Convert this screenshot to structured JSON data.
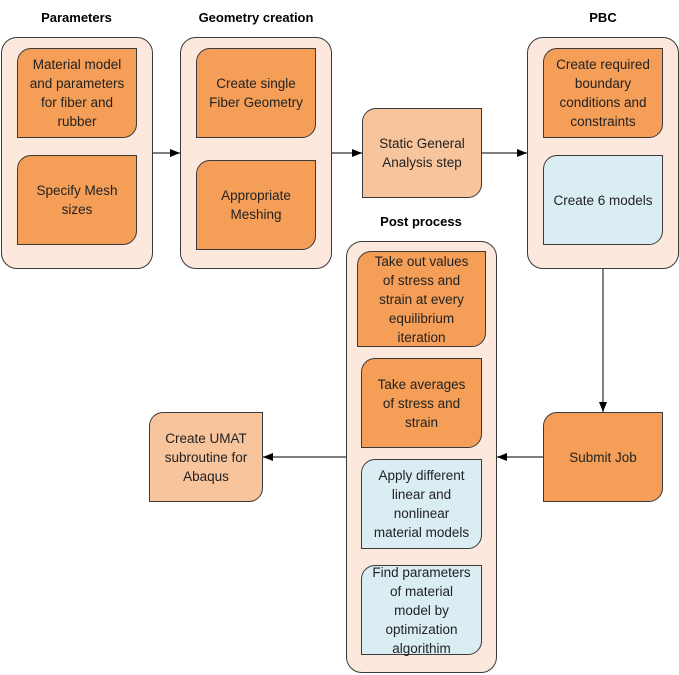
{
  "diagram": {
    "groups": {
      "parameters": {
        "title": "Parameters",
        "items": [
          "Material model\nand parameters\nfor fiber and\nrubber",
          "Specify Mesh\nsizes"
        ]
      },
      "geometry": {
        "title": "Geometry creation",
        "items": [
          "Create single\nFiber Geometry",
          "Appropriate\nMeshing"
        ]
      },
      "pbc": {
        "title": "PBC",
        "items": [
          "Create required\nboundary\nconditions and\nconstraints",
          "Create 6 models"
        ]
      },
      "post": {
        "title": "Post process",
        "items": [
          "Take out values\nof stress and\nstrain at every\nequilibrium\niteration",
          "Take averages\nof stress and\nstrain",
          "Apply different\nlinear and\nnonlinear\nmaterial models",
          "Find parameters\nof material\nmodel by\noptimization\nalgorithim"
        ]
      }
    },
    "nodes": {
      "static": "Static General\nAnalysis step",
      "submit": "Submit Job",
      "umat": "Create UMAT\nsubroutine for\nAbaqus"
    },
    "colors": {
      "group_fill": "#fce8dc",
      "orange": "#f59e58",
      "light_orange": "#f8c49c",
      "blue": "#daedf3",
      "stroke": "#3a3a3a"
    },
    "edges": [
      {
        "from": "Parameters",
        "to": "Geometry creation"
      },
      {
        "from": "Geometry creation",
        "to": "Static General Analysis step"
      },
      {
        "from": "Static General Analysis step",
        "to": "PBC"
      },
      {
        "from": "PBC",
        "to": "Submit Job"
      },
      {
        "from": "Submit Job",
        "to": "Post process"
      },
      {
        "from": "Post process",
        "to": "Create UMAT subroutine for Abaqus"
      }
    ]
  }
}
